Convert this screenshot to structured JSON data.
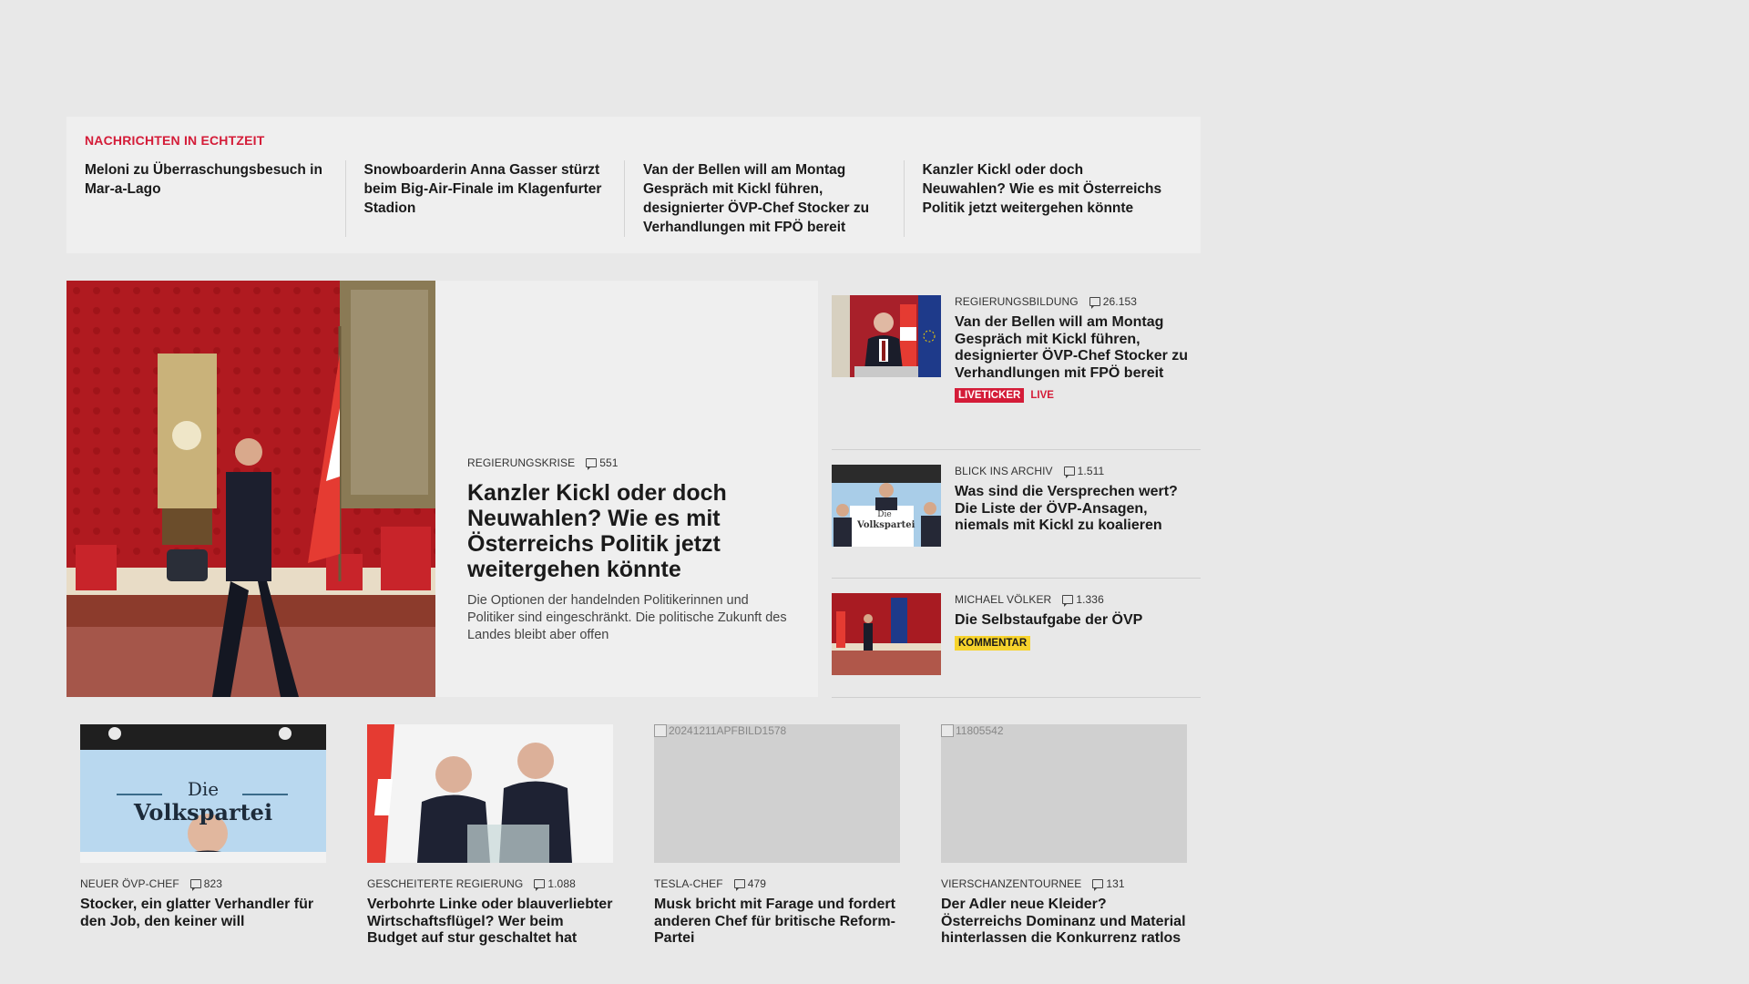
{
  "ticker": {
    "label": "NACHRICHTEN IN ECHTZEIT",
    "items": [
      "Meloni zu Überraschungsbesuch in Mar-a-Lago",
      "Snowboarderin Anna Gasser stürzt beim Big-Air-Finale im Klagenfurter Stadion",
      "Van der Bellen will am Montag Gespräch mit Kickl führen, designierter ÖVP-Chef Stocker zu Verhandlungen mit FPÖ bereit",
      "Kanzler Kickl oder doch Neuwahlen? Wie es mit Österreichs Politik jetzt weitergehen könnte"
    ]
  },
  "hero": {
    "kicker": "REGIERUNGSKRISE",
    "comments": "551",
    "title": "Kanzler Kickl oder doch Neuwahlen? Wie es mit Österreichs Politik jetzt weitergehen könnte",
    "description": "Die Optionen der handelnden Politikerinnen und Politiker sind eingeschränkt. Die politische Zukunft des Landes bleibt aber offen"
  },
  "side": [
    {
      "kicker": "REGIERUNGSBILDUNG",
      "comments": "26.153",
      "title": "Van der Bellen will am Montag Gespräch mit Kickl führen, designierter ÖVP-Chef Stocker zu Verhandlungen mit FPÖ bereit",
      "badge": "LIVETICKER",
      "live": "LIVE"
    },
    {
      "kicker": "BLICK INS ARCHIV",
      "comments": "1.511",
      "title": "Was sind die Versprechen wert? Die Liste der ÖVP-Ansagen, niemals mit Kickl zu koalieren",
      "thumb_text_1": "Die",
      "thumb_text_2": "Volkspartei"
    },
    {
      "kicker": "MICHAEL VÖLKER",
      "comments": "1.336",
      "title": "Die Selbstaufgabe der ÖVP",
      "badge": "KOMMENTAR"
    }
  ],
  "cards": [
    {
      "kicker": "NEUER ÖVP-CHEF",
      "comments": "823",
      "title": "Stocker, ein glatter Verhandler für den Job, den keiner will",
      "img_text_1": "Die",
      "img_text_2": "Volkspartei"
    },
    {
      "kicker": "GESCHEITERTE REGIERUNG",
      "comments": "1.088",
      "title": "Verbohrte Linke oder blauverliebter Wirtschaftsflügel? Wer beim Budget auf stur geschaltet hat"
    },
    {
      "kicker": "TESLA-CHEF",
      "comments": "479",
      "title": "Musk bricht mit Farage und fordert anderen Chef für britische Reform-Partei",
      "img_alt": "20241211APFBILD1578"
    },
    {
      "kicker": "VIERSCHANZENTOURNEE",
      "comments": "131",
      "title": "Der Adler neue Kleider? Österreichs Dominanz und Material hinterlassen die Konkurrenz ratlos",
      "img_alt": "11805542"
    }
  ],
  "colors": {
    "accent": "#d41c38",
    "comment_badge": "#f7d32c",
    "panel": "#efefef",
    "page": "#e8e8e8"
  }
}
